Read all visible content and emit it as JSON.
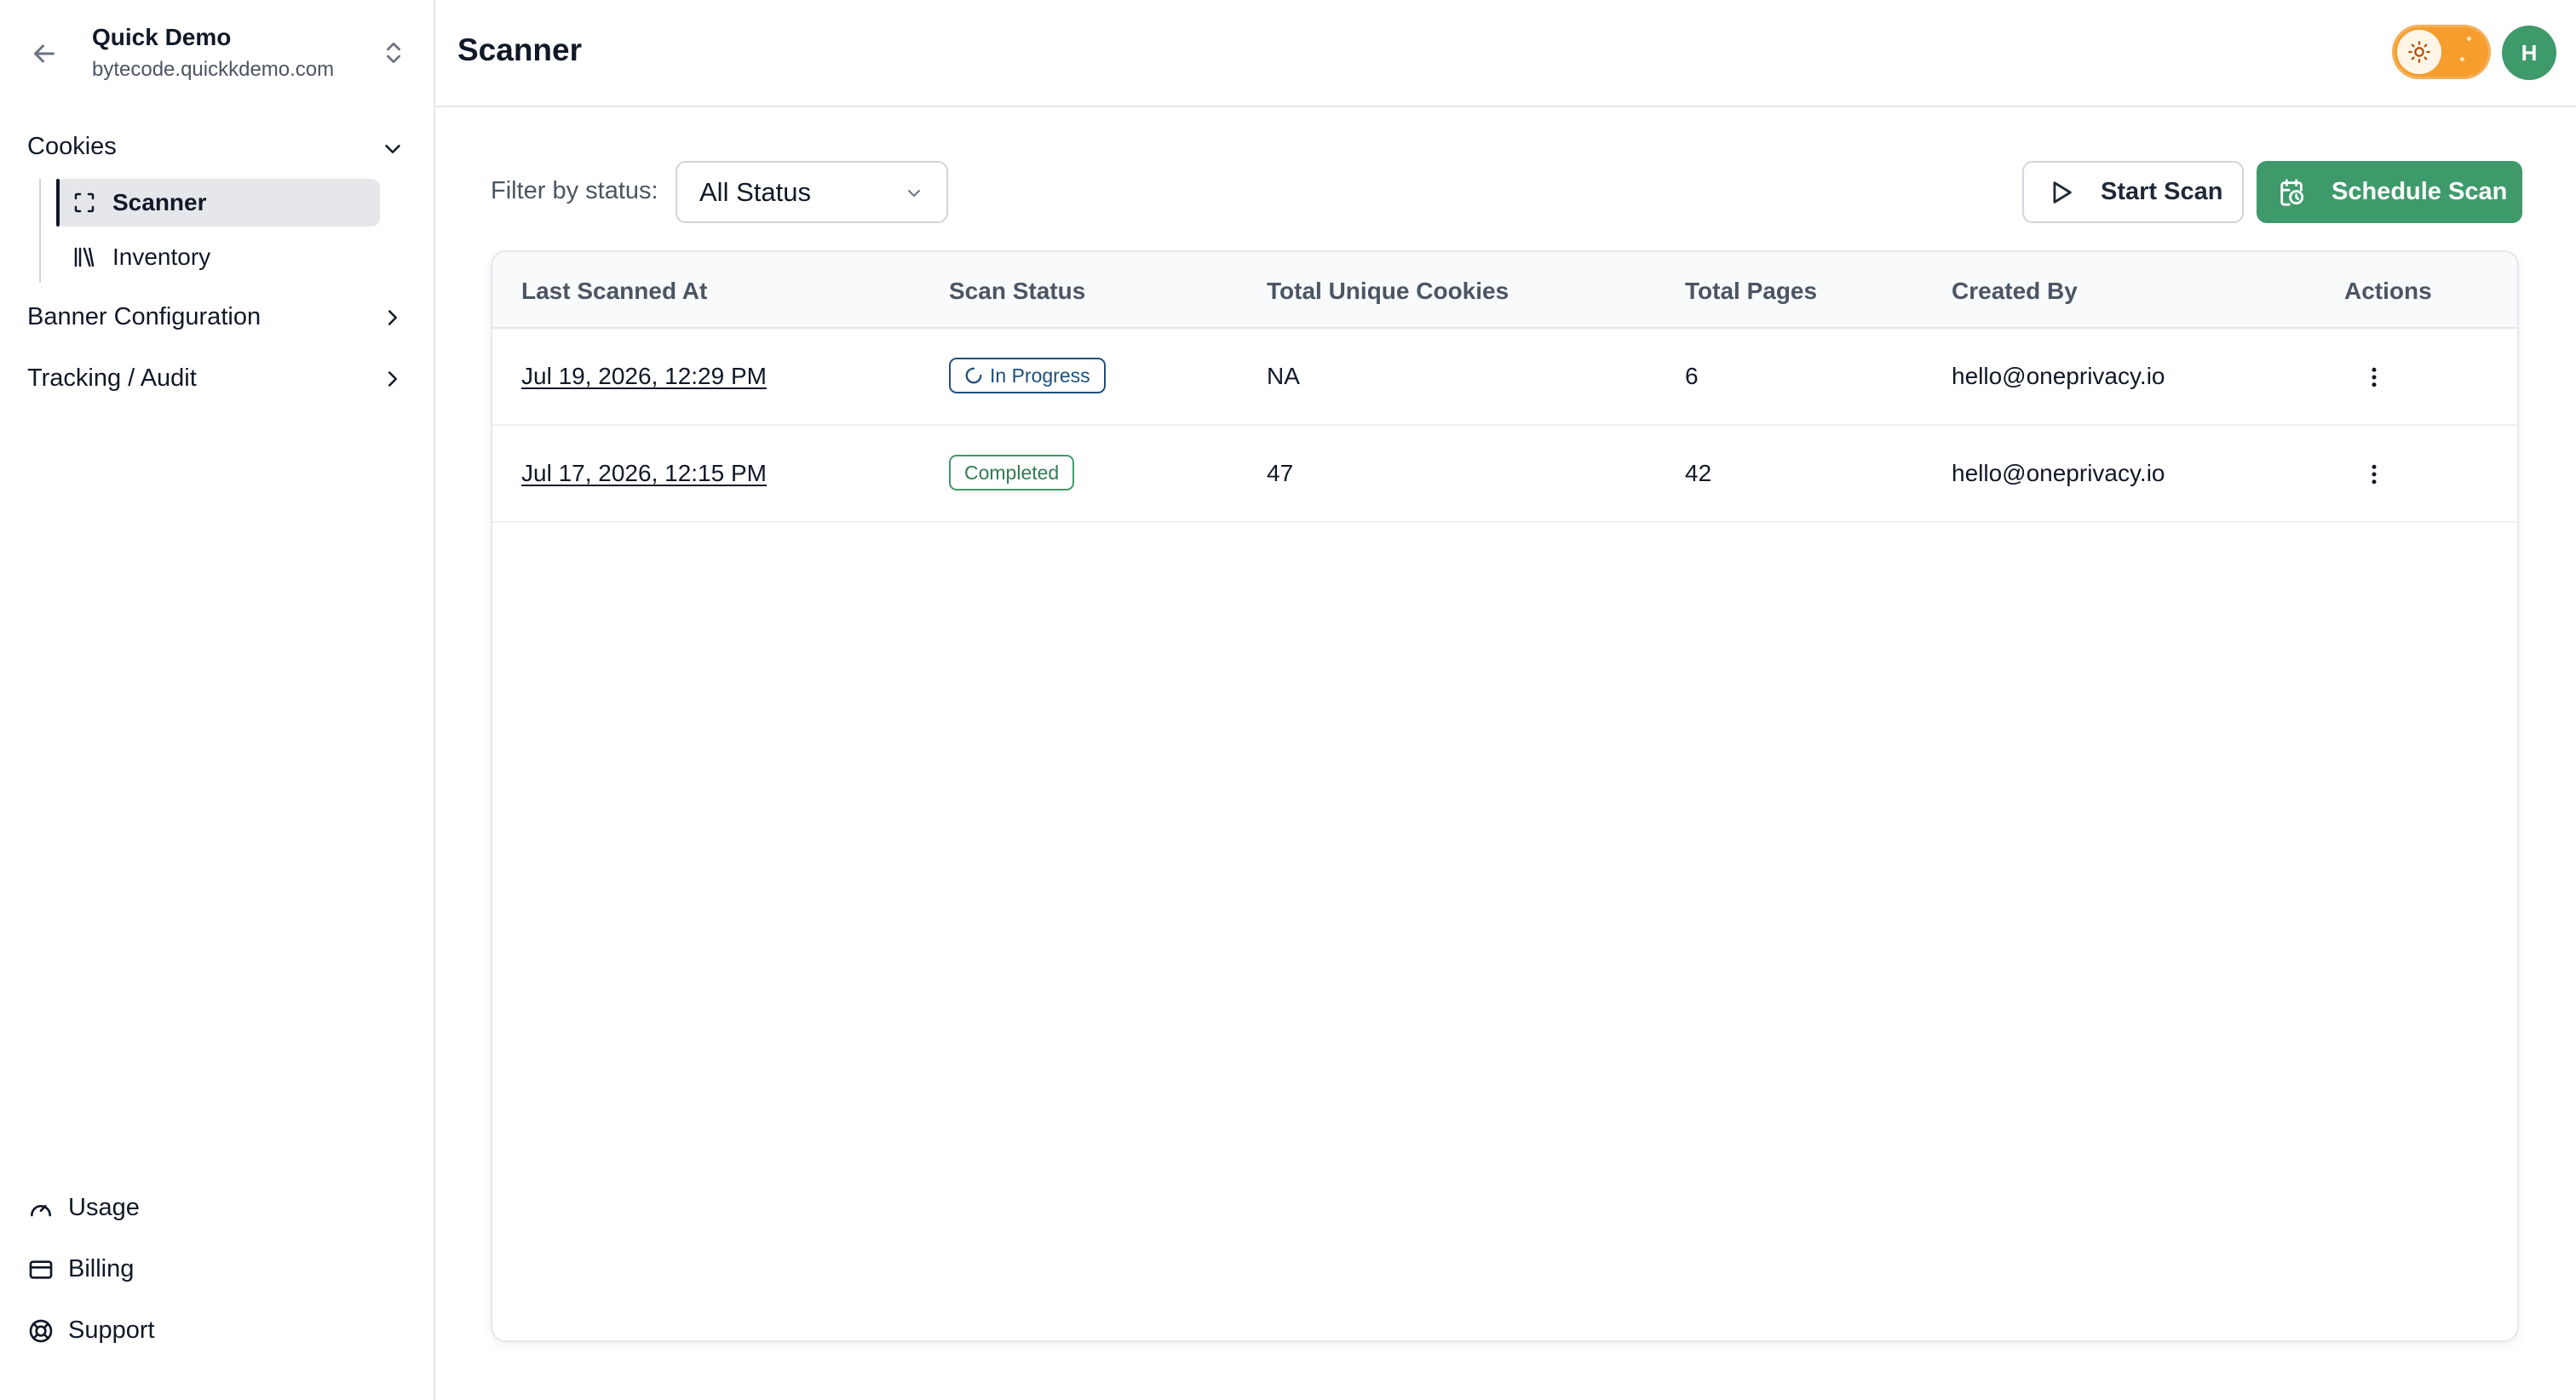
{
  "sidebar": {
    "project_name": "Quick Demo",
    "project_domain": "bytecode.quickkdemo.com",
    "groups": [
      {
        "label": "Cookies",
        "expanded": true
      },
      {
        "label": "Banner Configuration",
        "expanded": false
      },
      {
        "label": "Tracking / Audit",
        "expanded": false
      }
    ],
    "cookie_items": [
      {
        "label": "Scanner",
        "icon": "scan-icon",
        "active": true
      },
      {
        "label": "Inventory",
        "icon": "library-icon",
        "active": false
      }
    ],
    "footer_items": [
      {
        "label": "Usage",
        "icon": "gauge-icon"
      },
      {
        "label": "Billing",
        "icon": "credit-card-icon"
      },
      {
        "label": "Support",
        "icon": "lifebuoy-icon"
      }
    ]
  },
  "header": {
    "title": "Scanner",
    "avatar_initial": "H",
    "theme": "light"
  },
  "toolbar": {
    "filter_label": "Filter by status:",
    "filter_value": "All Status",
    "start_scan_label": "Start Scan",
    "schedule_scan_label": "Schedule Scan"
  },
  "table": {
    "columns": [
      "Last Scanned At",
      "Scan Status",
      "Total Unique Cookies",
      "Total Pages",
      "Created By",
      "Actions"
    ],
    "rows": [
      {
        "last_scanned": "Jul 19, 2026, 12:29 PM",
        "status": "In Progress",
        "cookies": "NA",
        "pages": "6",
        "created_by": "hello@oneprivacy.io"
      },
      {
        "last_scanned": "Jul 17, 2026, 12:15 PM",
        "status": "Completed",
        "cookies": "47",
        "pages": "42",
        "created_by": "hello@oneprivacy.io"
      }
    ]
  },
  "colors": {
    "accent_green": "#3f9a6b",
    "toggle_orange": "#f59e2e",
    "in_progress_blue": "#1e4f7a"
  }
}
